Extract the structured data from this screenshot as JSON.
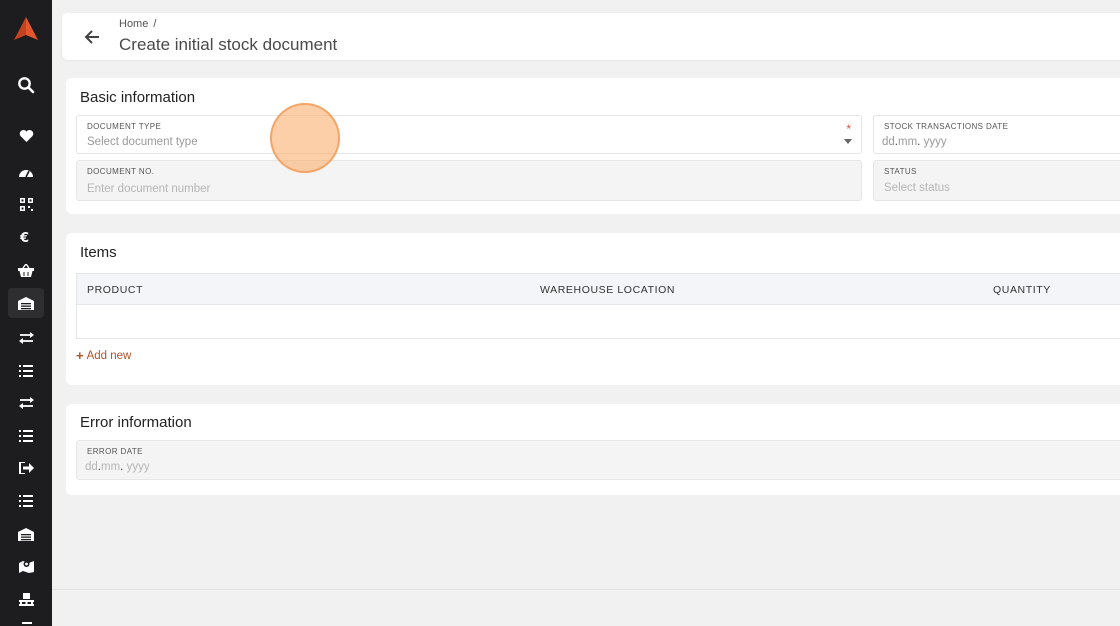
{
  "header": {
    "breadcrumb_home": "Home",
    "breadcrumb_sep": "/",
    "title": "Create initial stock document"
  },
  "basic_info": {
    "title": "Basic information",
    "document_type": {
      "label": "DOCUMENT TYPE",
      "placeholder": "Select document type",
      "required_mark": "*"
    },
    "stock_date": {
      "label": "STOCK TRANSACTIONS DATE",
      "dd": "dd",
      "mm": "mm",
      "yyyy": "yyyy",
      "dot": "."
    },
    "document_no": {
      "label": "DOCUMENT NO.",
      "placeholder": "Enter document number"
    },
    "status": {
      "label": "STATUS",
      "placeholder": "Select status"
    }
  },
  "items": {
    "title": "Items",
    "columns": [
      "PRODUCT",
      "WAREHOUSE LOCATION",
      "QUANTITY"
    ],
    "rows": [],
    "add_new_icon": "+",
    "add_new_label": "Add new"
  },
  "error_info": {
    "title": "Error information",
    "error_date": {
      "label": "ERROR DATE",
      "dd": "dd",
      "mm": "mm",
      "yyyy": "yyyy",
      "dot": "."
    }
  },
  "sidebar": {
    "icons": [
      "logo",
      "search-icon",
      "heart-icon",
      "dashboard-icon",
      "qr-code-icon",
      "euro-icon",
      "basket-icon",
      "warehouse-icon",
      "transfer-icon",
      "list-icon",
      "transfer-icon",
      "list-icon",
      "sign-out-icon",
      "list-icon",
      "warehouse-icon",
      "map-marker-icon",
      "pallet-icon"
    ]
  },
  "colors": {
    "sidebar_bg": "#1d1d1f",
    "accent": "#b0522a",
    "logo": "#e4572e",
    "click_highlight": "#faaf6e"
  }
}
